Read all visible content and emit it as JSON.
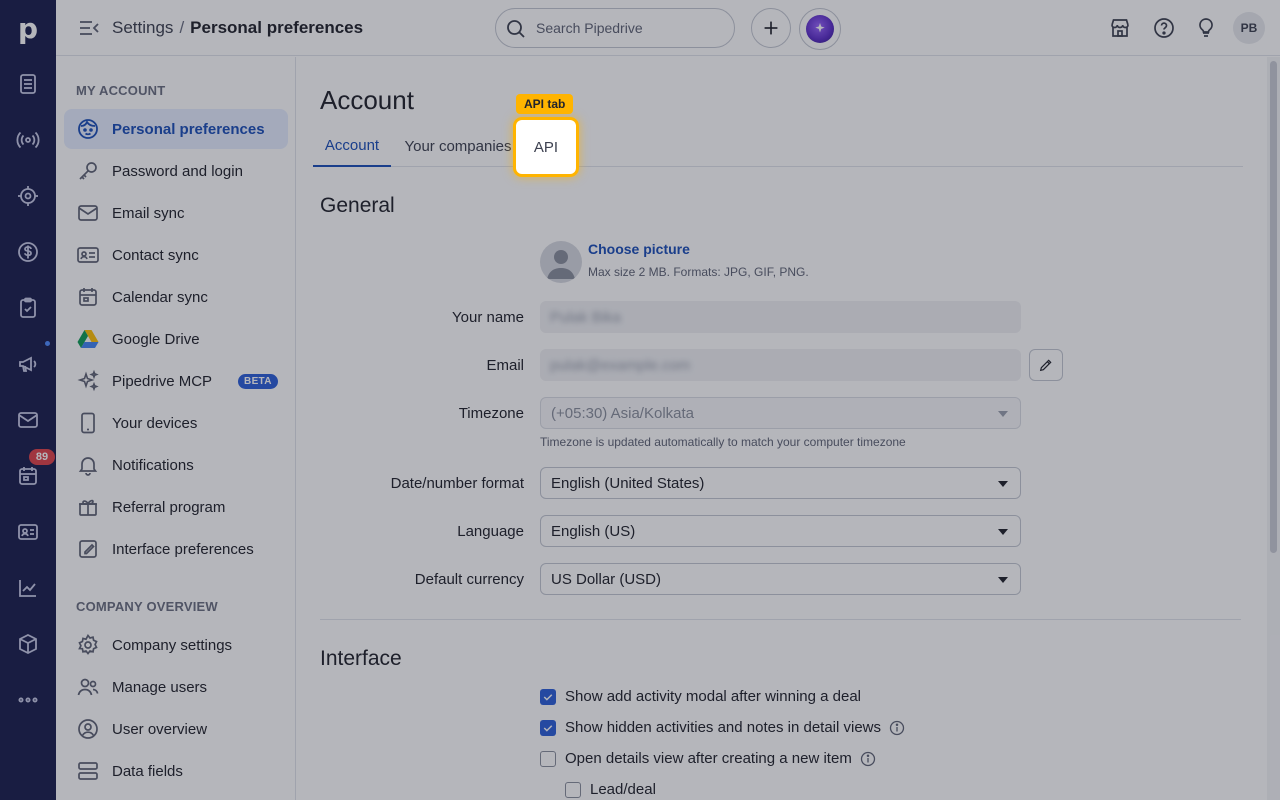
{
  "header": {
    "breadcrumb_parent": "Settings",
    "breadcrumb_sep": "/",
    "breadcrumb_current": "Personal preferences",
    "search_placeholder": "Search Pipedrive",
    "avatar_initials": "PB"
  },
  "leftnav": {
    "logo": "p",
    "activities_badge": "89"
  },
  "sidebar": {
    "my_account_heading": "MY ACCOUNT",
    "items": [
      {
        "label": "Personal preferences",
        "icon": "face-icon",
        "active": true
      },
      {
        "label": "Password and login",
        "icon": "key-icon"
      },
      {
        "label": "Email sync",
        "icon": "envelope-icon"
      },
      {
        "label": "Contact sync",
        "icon": "contact-card-icon"
      },
      {
        "label": "Calendar sync",
        "icon": "calendar-icon"
      },
      {
        "label": "Google Drive",
        "icon": "google-drive-icon"
      },
      {
        "label": "Pipedrive MCP",
        "icon": "sparkle-icon",
        "badge": "BETA"
      },
      {
        "label": "Your devices",
        "icon": "phone-icon"
      },
      {
        "label": "Notifications",
        "icon": "bell-icon"
      },
      {
        "label": "Referral program",
        "icon": "gift-icon"
      },
      {
        "label": "Interface preferences",
        "icon": "interface-edit-icon"
      }
    ],
    "company_heading": "COMPANY OVERVIEW",
    "company_items": [
      {
        "label": "Company settings",
        "icon": "gear-icon"
      },
      {
        "label": "Manage users",
        "icon": "users-icon"
      },
      {
        "label": "User overview",
        "icon": "user-circle-icon"
      },
      {
        "label": "Data fields",
        "icon": "data-fields-icon"
      }
    ]
  },
  "main": {
    "title": "Account",
    "tabs": [
      {
        "label": "Account",
        "active": true
      },
      {
        "label": "Your companies"
      },
      {
        "label": "API"
      }
    ],
    "tooltip": "API tab",
    "general_title": "General",
    "choose_picture": "Choose picture",
    "picture_hint": "Max size 2 MB. Formats: JPG, GIF, PNG.",
    "fields": {
      "name_label": "Your name",
      "name_value": "Pulak Bika",
      "email_label": "Email",
      "email_value": "pulak@example.com",
      "timezone_label": "Timezone",
      "timezone_value": "(+05:30) Asia/Kolkata",
      "timezone_hint": "Timezone is updated automatically to match your computer timezone",
      "date_label": "Date/number format",
      "date_value": "English (United States)",
      "language_label": "Language",
      "language_value": "English (US)",
      "currency_label": "Default currency",
      "currency_value": "US Dollar (USD)"
    },
    "interface_title": "Interface",
    "checkboxes": [
      {
        "label": "Show add activity modal after winning a deal",
        "checked": true
      },
      {
        "label": "Show hidden activities and notes in detail views",
        "checked": true
      },
      {
        "label": "Open details view after creating a new item",
        "checked": false
      },
      {
        "label": "Lead/deal",
        "checked": false
      }
    ]
  },
  "colors": {
    "nav_bg": "#1a1e4d",
    "accent": "#1b4fb8",
    "highlight": "#ffb400"
  }
}
